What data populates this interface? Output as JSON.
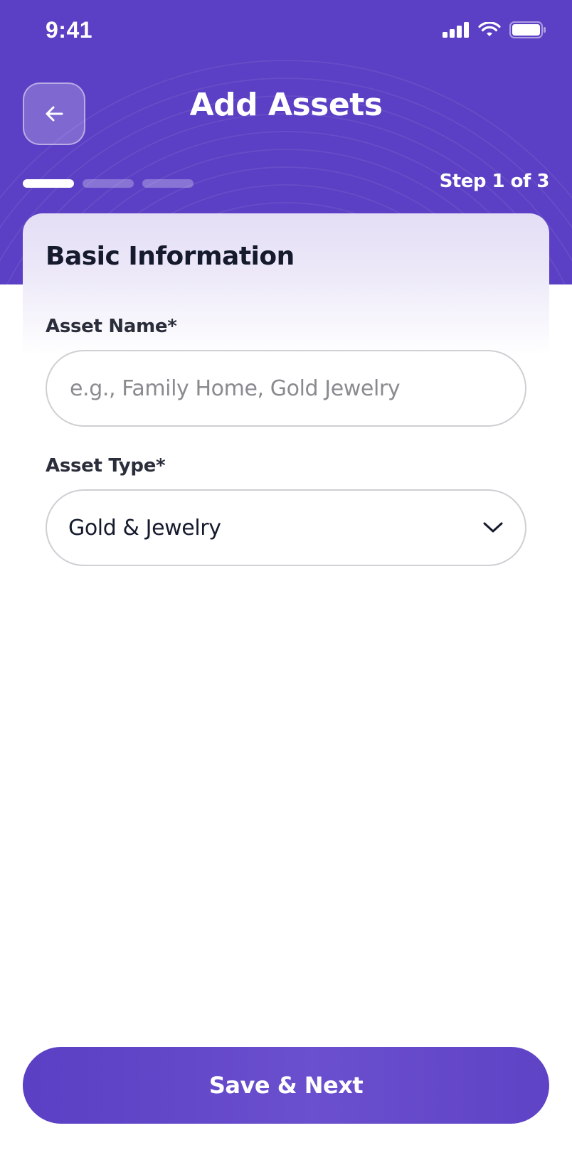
{
  "status_bar": {
    "time": "9:41"
  },
  "header": {
    "title": "Add Assets",
    "step_label": "Step 1 of 3",
    "progress": {
      "current_step": 1,
      "total_steps": 3
    }
  },
  "form": {
    "section_title": "Basic Information",
    "asset_name": {
      "label": "Asset Name*",
      "value": "",
      "placeholder": "e.g., Family Home, Gold Jewelry"
    },
    "asset_type": {
      "label": "Asset Type*",
      "selected": "Gold & Jewelry"
    }
  },
  "actions": {
    "primary_label": "Save & Next"
  },
  "colors": {
    "brand": "#5b3fc4",
    "text_dark": "#151a2d",
    "placeholder": "#8a8a90",
    "border": "#cfcfd4"
  },
  "icons": {
    "back": "arrow-left-icon",
    "dropdown": "chevron-down-icon",
    "signal": "cellular-signal-icon",
    "wifi": "wifi-icon",
    "battery": "battery-icon"
  }
}
